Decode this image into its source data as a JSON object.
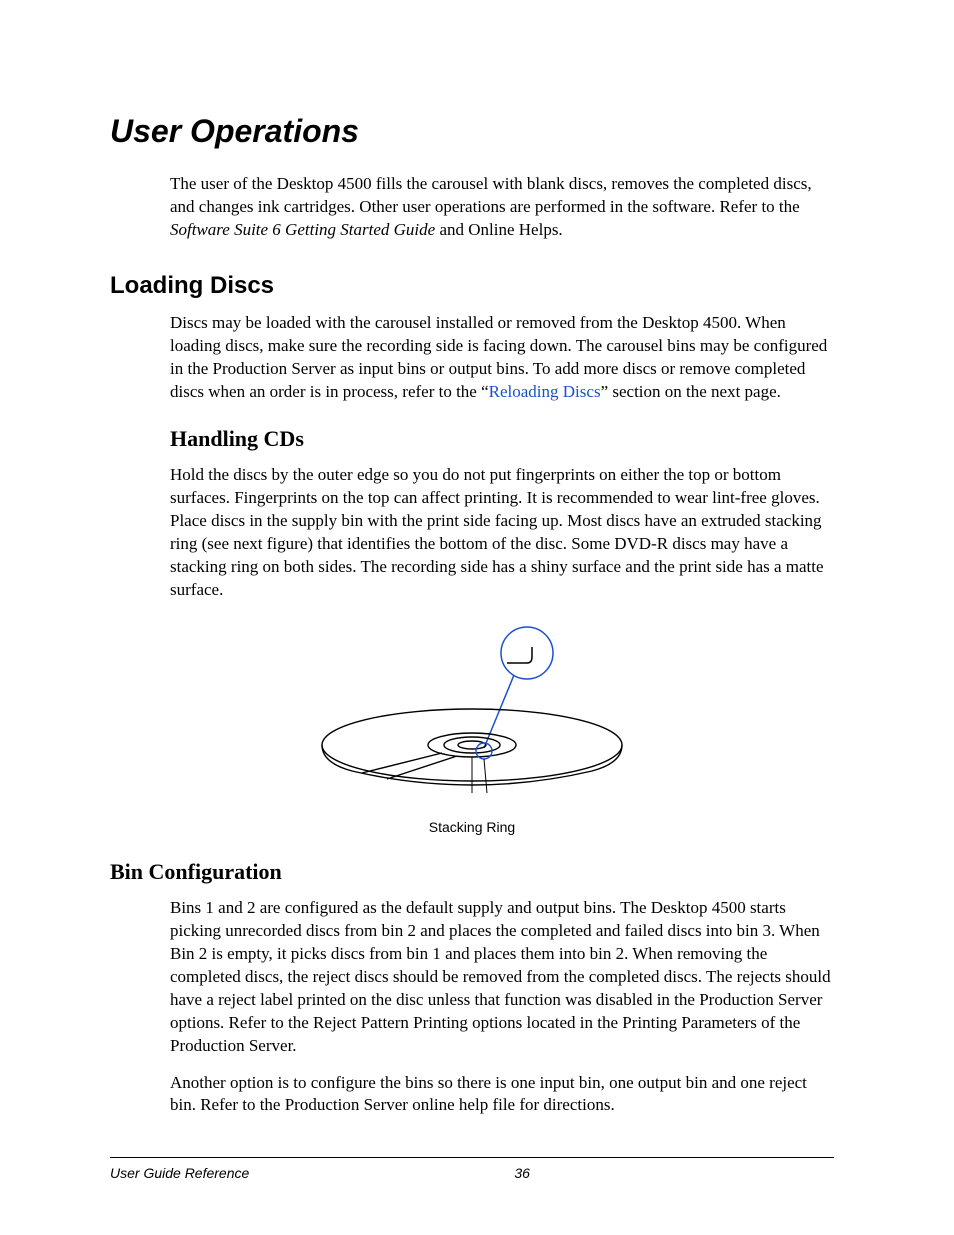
{
  "headings": {
    "h1": "User Operations",
    "h2_loading": "Loading Discs",
    "h3_handling": "Handling CDs",
    "h3_binconfig": "Bin Configuration"
  },
  "intro": {
    "t1": "The user of the Desktop 4500 fills the carousel with blank discs, removes the completed discs, and changes ink cartridges. Other user operations are performed in the software. Refer to the ",
    "t1_italic": "Software Suite 6 Getting Started Guide",
    "t1_after": " and Online Helps."
  },
  "loading": {
    "t1_before": "Discs may be loaded with the carousel installed or removed from the Desktop 4500. When loading discs, make sure the recording side is facing down. The carousel bins may be configured in the Production Server as input bins or output bins. To add more discs or remove completed discs when an order is in process, refer to the “",
    "link": "Reloading Discs",
    "t1_after": "” section on the next page."
  },
  "handling": {
    "t1": "Hold the discs by the outer edge so you do not put fingerprints on either the top or bottom surfaces.  Fingerprints on the top can affect printing.  It is recommended to wear lint-free gloves.  Place discs in the supply bin with the print side facing up.  Most discs have an extruded stacking ring (see next figure) that identifies the bottom of the disc. Some DVD-R discs may have a stacking ring on both sides. The recording side has a shiny surface and the print side has a matte surface."
  },
  "figure": {
    "caption": "Stacking Ring"
  },
  "binconfig": {
    "t1": "Bins 1 and 2 are configured as the default supply and output bins. The Desktop 4500 starts picking unrecorded discs from bin 2 and places the completed and failed discs into bin 3. When Bin 2 is empty, it picks discs from bin 1 and places them into bin 2. When removing the completed discs, the reject discs should be removed from the completed discs. The rejects should have a reject label printed on the disc unless that function was disabled in the Production Server options. Refer to the Reject Pattern Printing options located in the Printing Parameters of the Production Server.",
    "t2": "Another option is to configure the bins so there is one input bin, one output bin and one reject bin. Refer to the Production Server online help file for directions."
  },
  "footer": {
    "title": "User Guide Reference",
    "page": "36"
  }
}
